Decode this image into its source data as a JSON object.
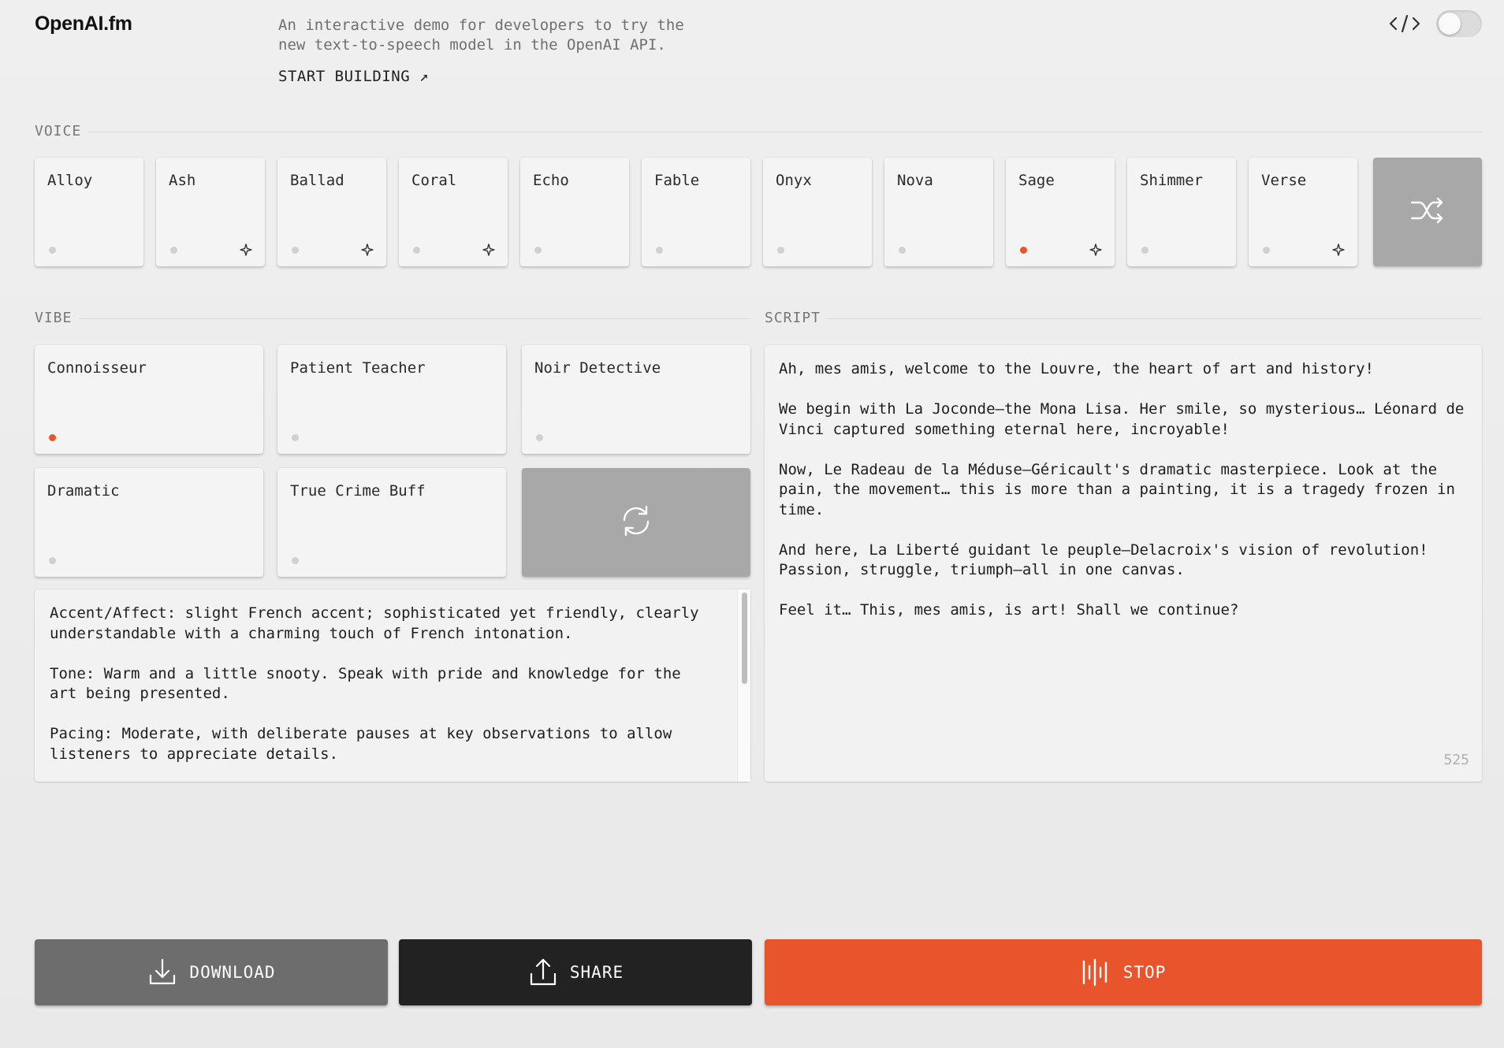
{
  "header": {
    "logo": "OpenAI.fm",
    "intro": "An interactive demo for developers to try the new text-to-speech model in the OpenAI API.",
    "start_building": "START BUILDING ↗",
    "code_icon": "code-icon",
    "toggle_on": false
  },
  "voice": {
    "label": "VOICE",
    "items": [
      {
        "label": "Alloy",
        "selected": false,
        "new": false
      },
      {
        "label": "Ash",
        "selected": false,
        "new": true
      },
      {
        "label": "Ballad",
        "selected": false,
        "new": true
      },
      {
        "label": "Coral",
        "selected": false,
        "new": true
      },
      {
        "label": "Echo",
        "selected": false,
        "new": false
      },
      {
        "label": "Fable",
        "selected": false,
        "new": false
      },
      {
        "label": "Onyx",
        "selected": false,
        "new": false
      },
      {
        "label": "Nova",
        "selected": false,
        "new": false
      },
      {
        "label": "Sage",
        "selected": true,
        "new": true
      },
      {
        "label": "Shimmer",
        "selected": false,
        "new": false
      },
      {
        "label": "Verse",
        "selected": false,
        "new": true
      }
    ],
    "shuffle_icon": "shuffle-icon"
  },
  "vibe": {
    "label": "VIBE",
    "items": [
      {
        "label": "Connoisseur",
        "selected": true
      },
      {
        "label": "Patient Teacher",
        "selected": false
      },
      {
        "label": "Noir Detective",
        "selected": false
      },
      {
        "label": "Dramatic",
        "selected": false
      },
      {
        "label": "True Crime Buff",
        "selected": false
      }
    ],
    "refresh_icon": "refresh-icon",
    "text": "Accent/Affect: slight French accent; sophisticated yet friendly, clearly understandable with a charming touch of French intonation.\n\nTone: Warm and a little snooty. Speak with pride and knowledge for the art being presented.\n\nPacing: Moderate, with deliberate pauses at key observations to allow listeners to appreciate details."
  },
  "script": {
    "label": "SCRIPT",
    "text": "Ah, mes amis, welcome to the Louvre, the heart of art and history!\n\nWe begin with La Joconde—the Mona Lisa. Her smile, so mysterious… Léonard de Vinci captured something eternal here, incroyable!\n\nNow, Le Radeau de la Méduse—Géricault's dramatic masterpiece. Look at the pain, the movement… this is more than a painting, it is a tragedy frozen in time.\n\nAnd here, La Liberté guidant le peuple—Delacroix's vision of revolution! Passion, struggle, triumph—all in one canvas.\n\nFeel it… This, mes amis, is art! Shall we continue?",
    "char_count": "525"
  },
  "actions": {
    "download": "DOWNLOAD",
    "share": "SHARE",
    "stop": "STOP"
  },
  "colors": {
    "accent": "#e8552c",
    "download_bg": "#6d6d6d",
    "share_bg": "#222222"
  }
}
